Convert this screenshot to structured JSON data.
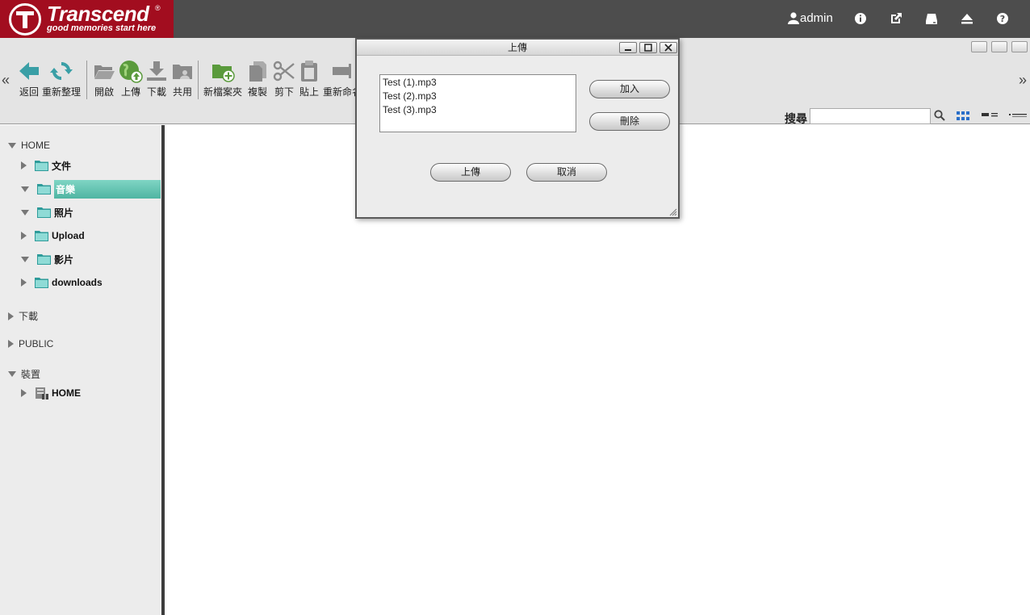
{
  "header": {
    "brand_name": "Transcend",
    "brand_reg": "®",
    "brand_tagline": "good memories start here",
    "user": "admin",
    "icons": [
      "info-icon",
      "external-link-icon",
      "drive-icon",
      "eject-icon",
      "help-icon"
    ]
  },
  "toolbar": {
    "buttons": [
      {
        "label": "返回",
        "icon": "back-arrow-icon"
      },
      {
        "label": "重新整理",
        "icon": "refresh-icon"
      },
      {
        "label": "開啟",
        "icon": "open-folder-icon"
      },
      {
        "label": "上傳",
        "icon": "upload-globe-icon"
      },
      {
        "label": "下載",
        "icon": "download-icon"
      },
      {
        "label": "共用",
        "icon": "share-folder-icon"
      },
      {
        "label": "新檔案夾",
        "icon": "new-folder-icon"
      },
      {
        "label": "複製",
        "icon": "copy-icon"
      },
      {
        "label": "剪下",
        "icon": "scissors-icon"
      },
      {
        "label": "貼上",
        "icon": "paste-icon"
      },
      {
        "label": "重新命名",
        "icon": "rename-icon"
      }
    ],
    "search_label": "搜尋",
    "search_value": ""
  },
  "sidebar": {
    "home": "HOME",
    "home_children": [
      {
        "label": "文件",
        "expanded": false
      },
      {
        "label": "音樂",
        "expanded": true,
        "selected": true
      },
      {
        "label": "照片",
        "expanded": true
      },
      {
        "label": "Upload",
        "expanded": false
      },
      {
        "label": "影片",
        "expanded": true
      },
      {
        "label": "downloads",
        "expanded": false
      }
    ],
    "download": "下載",
    "public": "PUBLIC",
    "devices": "裝置",
    "devices_children": [
      {
        "label": "HOME"
      }
    ]
  },
  "dialog": {
    "title": "上傳",
    "files": [
      "Test (1).mp3",
      "Test (2).mp3",
      "Test (3).mp3"
    ],
    "add_label": "加入",
    "delete_label": "刪除",
    "upload_label": "上傳",
    "cancel_label": "取消"
  },
  "colors": {
    "brand_red": "#a20d1f",
    "header_gray": "#4d4d4d",
    "selected_teal": "#5fbfad",
    "toolbar_green": "#5a9a3c",
    "toolbar_teal": "#3a9fa6"
  }
}
